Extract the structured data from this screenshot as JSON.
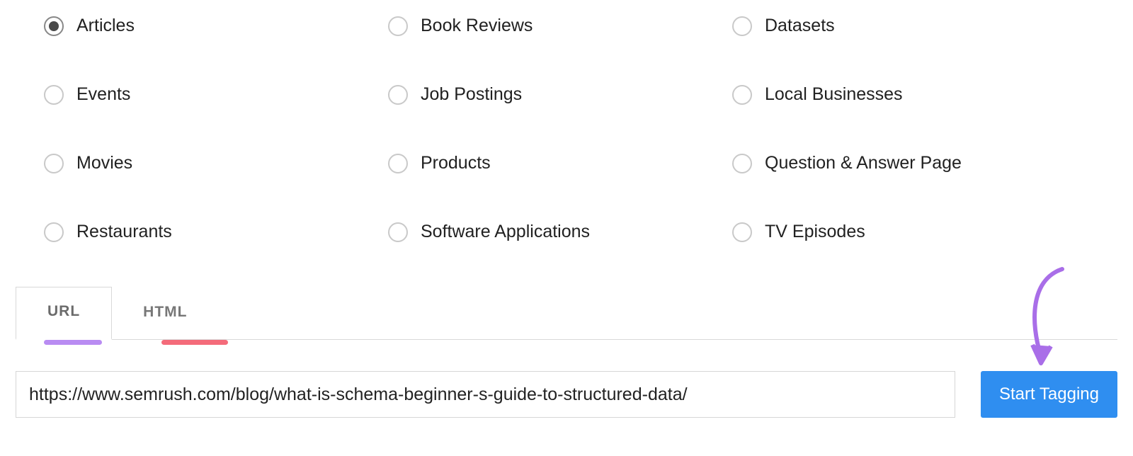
{
  "radio_options": {
    "col1": [
      {
        "id": "articles",
        "label": "Articles",
        "selected": true
      },
      {
        "id": "events",
        "label": "Events",
        "selected": false
      },
      {
        "id": "movies",
        "label": "Movies",
        "selected": false
      },
      {
        "id": "restaurants",
        "label": "Restaurants",
        "selected": false
      }
    ],
    "col2": [
      {
        "id": "book-reviews",
        "label": "Book Reviews",
        "selected": false
      },
      {
        "id": "job-postings",
        "label": "Job Postings",
        "selected": false
      },
      {
        "id": "products",
        "label": "Products",
        "selected": false
      },
      {
        "id": "software-applications",
        "label": "Software Applications",
        "selected": false
      }
    ],
    "col3": [
      {
        "id": "datasets",
        "label": "Datasets",
        "selected": false
      },
      {
        "id": "local-businesses",
        "label": "Local Businesses",
        "selected": false
      },
      {
        "id": "qa-page",
        "label": "Question & Answer Page",
        "selected": false
      },
      {
        "id": "tv-episodes",
        "label": "TV Episodes",
        "selected": false
      }
    ]
  },
  "tabs": {
    "url": {
      "label": "URL",
      "active": true
    },
    "html": {
      "label": "HTML",
      "active": false
    }
  },
  "input": {
    "value": "https://www.semrush.com/blog/what-is-schema-beginner-s-guide-to-structured-data/"
  },
  "button": {
    "start_tagging": "Start Tagging"
  },
  "colors": {
    "primary_button": "#2f8ef0",
    "url_underline": "#b98cf2",
    "html_underline": "#f46b7a",
    "annotation_arrow": "#a96ee8"
  }
}
